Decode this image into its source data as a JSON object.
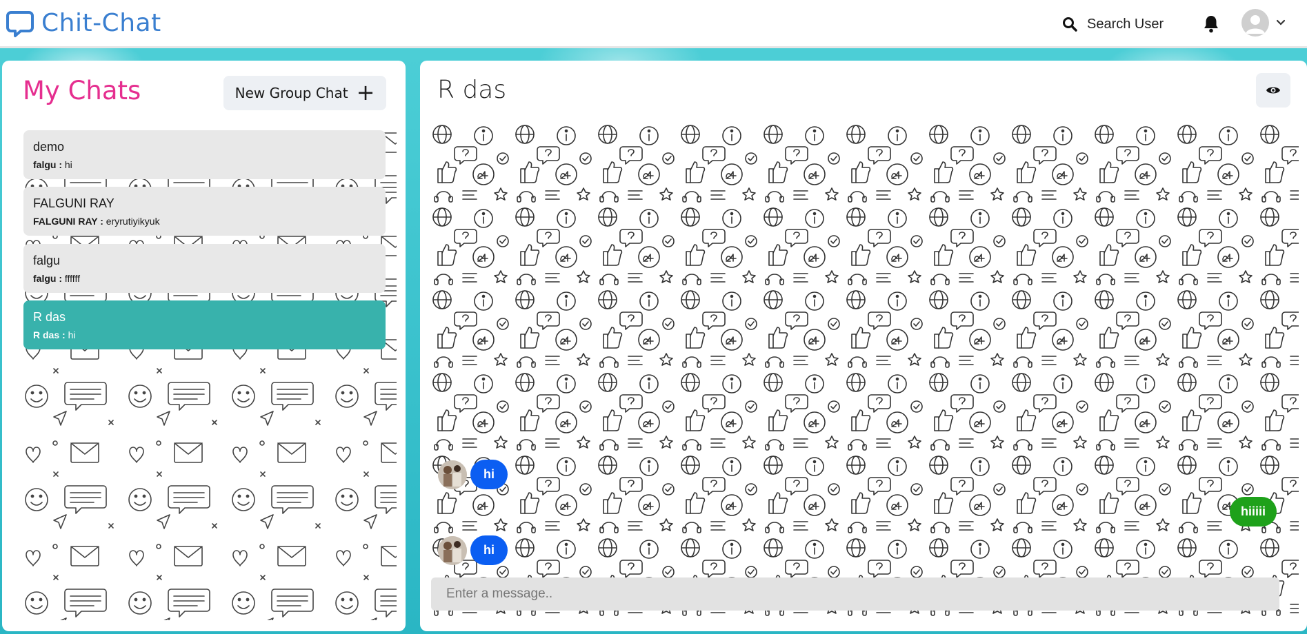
{
  "header": {
    "brand": "Chit-Chat",
    "search_label": "Search User",
    "icons": {
      "brand": "chat-bubble-icon",
      "search": "search-icon",
      "bell": "bell-icon",
      "avatar": "user-avatar-icon",
      "dropdown": "chevron-down-icon"
    },
    "brand_color": "#3a7fd0"
  },
  "sidebar": {
    "title": "My Chats",
    "title_color": "#e52e8f",
    "new_group_label": "New Group Chat",
    "chats": [
      {
        "name": "demo",
        "sender": "falgu :",
        "message": "hi",
        "active": false
      },
      {
        "name": "FALGUNI RAY",
        "sender": "FALGUNI RAY :",
        "message": "eryrutiyikyuk",
        "active": false
      },
      {
        "name": "falgu",
        "sender": "falgu :",
        "message": "ffffff",
        "active": false
      },
      {
        "name": "R das",
        "sender": "R das :",
        "message": "hi",
        "active": true
      }
    ],
    "active_color": "#38b2ac"
  },
  "chat": {
    "title": "R das",
    "eye_icon": "eye-icon",
    "messages": [
      {
        "text": "hi",
        "direction": "incoming"
      },
      {
        "text": "hiiiii",
        "direction": "outgoing"
      },
      {
        "text": "hi",
        "direction": "incoming"
      }
    ],
    "incoming_color": "#0b5ef2",
    "outgoing_color": "#1ea11a",
    "input_placeholder": "Enter a message.."
  }
}
